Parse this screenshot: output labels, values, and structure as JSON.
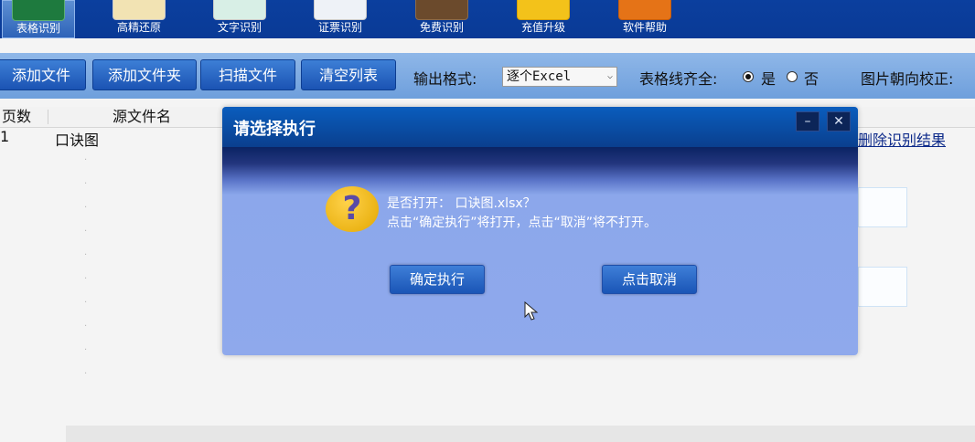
{
  "toolbar": {
    "items": [
      {
        "label": "表格识别",
        "icon": "excel-icon"
      },
      {
        "label": "高精还原",
        "icon": "document-icon"
      },
      {
        "label": "文字识别",
        "icon": "text-doc-icon"
      },
      {
        "label": "证票识别",
        "icon": "id-card-icon"
      },
      {
        "label": "免费识别",
        "icon": "book-icon"
      },
      {
        "label": "充值升级",
        "icon": "coin-icon"
      },
      {
        "label": "软件帮助",
        "icon": "help-icon"
      }
    ]
  },
  "actions": {
    "add_file": "添加文件",
    "add_folder": "添加文件夹",
    "scan_file": "扫描文件",
    "clear_list": "清空列表",
    "output_format_label": "输出格式:",
    "output_format_value": "逐个Excel",
    "table_line_label": "表格线齐全:",
    "yes": "是",
    "no": "否",
    "orientation_label": "图片朝向校正:"
  },
  "table": {
    "headers": [
      "页数",
      "源文件名"
    ],
    "rows": [
      {
        "pages": "1",
        "name": "口诀图",
        "action": "删除识别结果"
      }
    ]
  },
  "dialog": {
    "title": "请选择执行",
    "minimize": "–",
    "close": "✕",
    "line1": "是否打开： 口诀图.xlsx？",
    "line2": "点击“确定执行”将打开，点击“取消”将不打开。",
    "confirm": "确定执行",
    "cancel": "点击取消"
  },
  "colors": {
    "toolbar_bg": "#0b3f9e",
    "dialog_bg": "#8aa6ea",
    "button_blue": "#1b53b3"
  }
}
